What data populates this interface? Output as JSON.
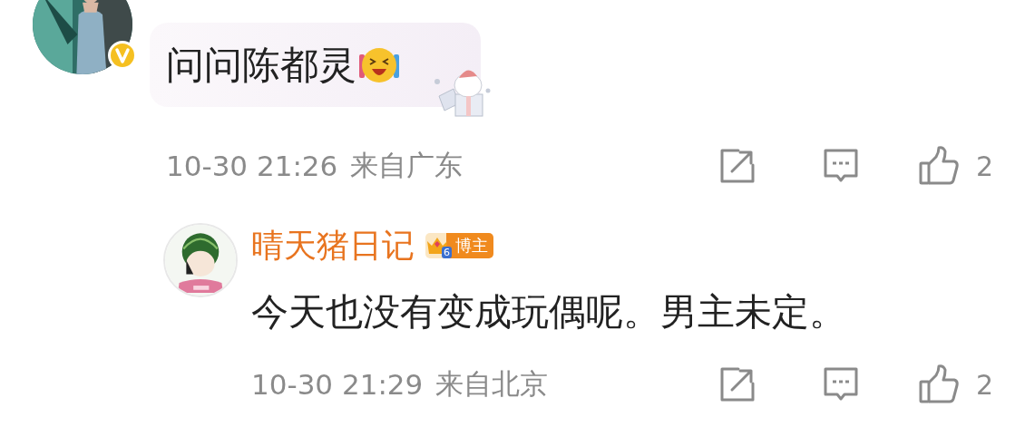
{
  "comments": [
    {
      "kind": "comment",
      "avatar": {
        "kind": "picture",
        "verified": true
      },
      "text": "问问陈都灵",
      "time": "10-30 21:26",
      "location": "来自广东",
      "likes": "2"
    },
    {
      "kind": "reply",
      "avatar": {
        "kind": "picture",
        "verified": false
      },
      "author": "晴天猪日记",
      "badge": {
        "level": "6",
        "label": "博主"
      },
      "text": "今天也没有变成玩偶呢。男主未定。",
      "time": "10-30 21:29",
      "location": "来自北京",
      "likes": "2"
    }
  ]
}
